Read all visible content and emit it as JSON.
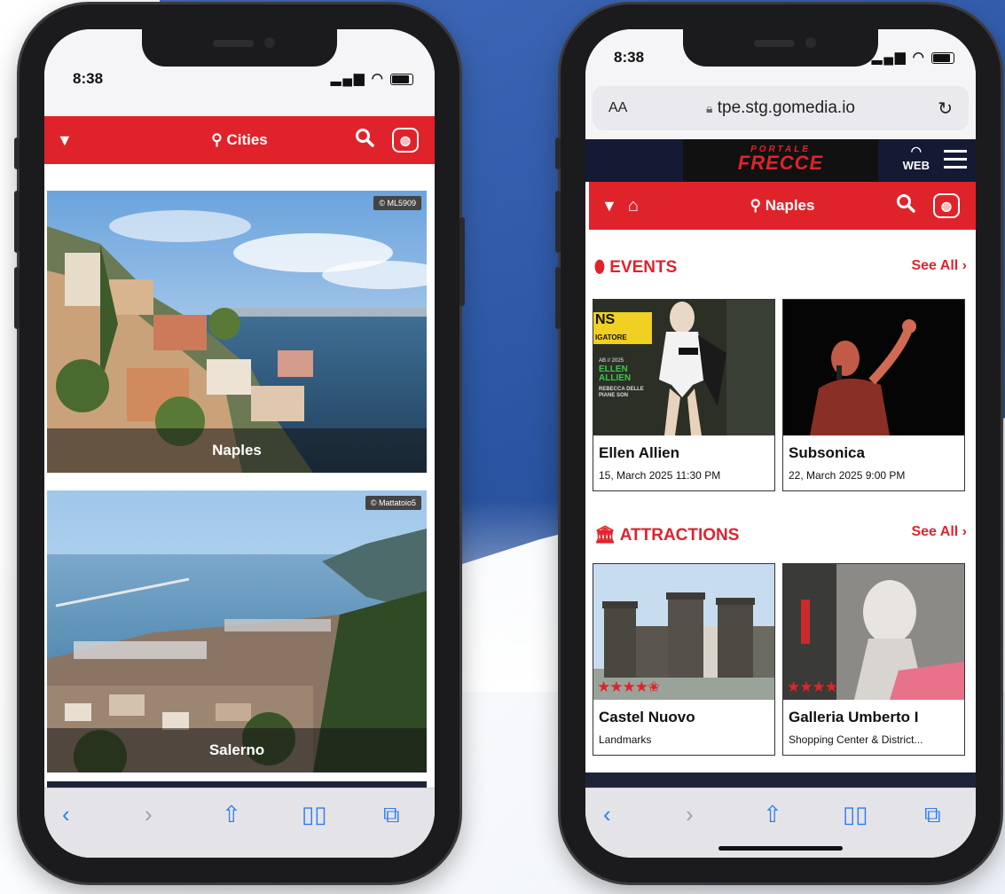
{
  "left_phone": {
    "status": {
      "time": "8:38"
    },
    "navbar": {
      "title": "Cities"
    },
    "cities": [
      {
        "name": "Naples",
        "credit": "ML5909"
      },
      {
        "name": "Salerno",
        "credit": "Mattatoio5"
      }
    ]
  },
  "right_phone": {
    "status": {
      "time": "8:38"
    },
    "url": {
      "aa": "AA",
      "domain": "tpe.stg.gomedia.io"
    },
    "portal": {
      "logo_top": "PORTALE",
      "logo_bottom": "FRECCE",
      "web_label": "WEB"
    },
    "navbar": {
      "title": "Naples"
    },
    "events": {
      "heading": "EVENTS",
      "see_all": "See All",
      "items": [
        {
          "title": "Ellen Allien",
          "date": "15, March 2025 11:30 PM",
          "poster_text": "ELLEN ALLIEN",
          "poster_sub": "REBECCA DELLE PIANE SON",
          "poster_sign": "NS",
          "poster_sign2": "IGATORE",
          "poster_date": "AB // 2025"
        },
        {
          "title": "Subsonica",
          "date": "22, March 2025 9:00 PM"
        }
      ]
    },
    "attractions": {
      "heading": "ATTRACTIONS",
      "see_all": "See All",
      "items": [
        {
          "title": "Castel Nuovo",
          "category": "Landmarks",
          "stars": "★★★★✬",
          "rating": 4.5
        },
        {
          "title": "Galleria Umberto I",
          "category": "Shopping Center & District...",
          "stars": "★★★★",
          "rating": 4
        }
      ]
    }
  },
  "colors": {
    "accent": "#e0232b",
    "ios_blue": "#2d7cf6",
    "bg_blue": "#2f5aa8"
  },
  "icons": [
    "caret-down-icon",
    "location-pin-icon",
    "search-icon",
    "chat-globe-icon",
    "home-icon",
    "ticket-icon",
    "museum-icon",
    "back-icon",
    "forward-icon",
    "share-icon",
    "bookmarks-icon",
    "tabs-icon",
    "reload-icon",
    "lock-icon",
    "wifi-icon",
    "signal-icon",
    "battery-icon",
    "menu-icon"
  ]
}
